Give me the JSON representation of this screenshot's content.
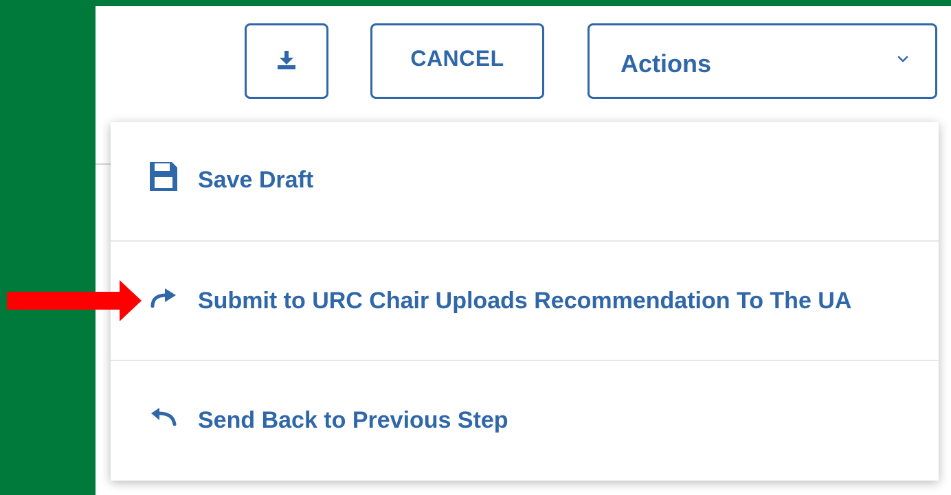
{
  "toolbar": {
    "download_icon": "download-icon",
    "cancel_label": "CANCEL",
    "actions_label": "Actions",
    "actions_chevron_icon": "chevron-down-icon"
  },
  "menu": {
    "items": [
      {
        "label": "Save Draft",
        "icon": "save-icon"
      },
      {
        "label": "Submit to URC Chair Uploads Recommendation To The UA",
        "icon": "redo-arrow-icon"
      },
      {
        "label": "Send Back to Previous Step",
        "icon": "undo-arrow-icon"
      }
    ]
  },
  "annotation": {
    "icon": "red-pointer-arrow",
    "color": "#ff0000"
  },
  "colors": {
    "background_green": "#007a3a",
    "accent_blue": "#2f67a8",
    "panel": "#ffffff"
  }
}
